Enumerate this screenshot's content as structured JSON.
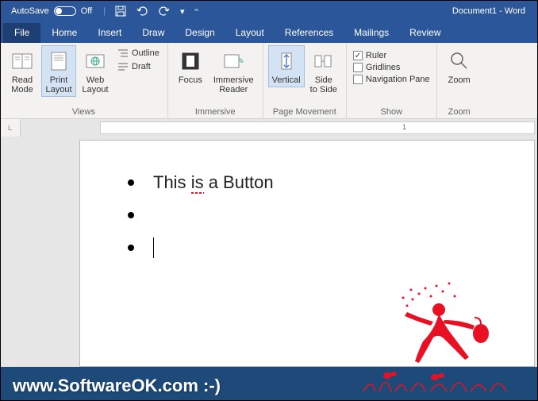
{
  "titlebar": {
    "autosave_label": "AutoSave",
    "autosave_state": "Off",
    "doc_title": "Document1 - Word"
  },
  "tabs": {
    "file": "File",
    "items": [
      "Home",
      "Insert",
      "Draw",
      "Design",
      "Layout",
      "References",
      "Mailings",
      "Review"
    ]
  },
  "ribbon": {
    "views": {
      "label": "Views",
      "read_mode": "Read\nMode",
      "print_layout": "Print\nLayout",
      "web_layout": "Web\nLayout",
      "outline": "Outline",
      "draft": "Draft"
    },
    "immersive": {
      "label": "Immersive",
      "focus": "Focus",
      "reader": "Immersive\nReader"
    },
    "page_movement": {
      "label": "Page Movement",
      "vertical": "Vertical",
      "side": "Side\nto Side"
    },
    "show": {
      "label": "Show",
      "ruler": "Ruler",
      "gridlines": "Gridlines",
      "navpane": "Navigation Pane"
    },
    "zoom": {
      "label": "Zoom",
      "zoom": "Zoom"
    }
  },
  "ruler": {
    "corner": "L",
    "mark1": "1"
  },
  "document": {
    "line1": "This is a Button",
    "spell_word": "is"
  },
  "watermark": "www.SoftwareOK.com :-)"
}
